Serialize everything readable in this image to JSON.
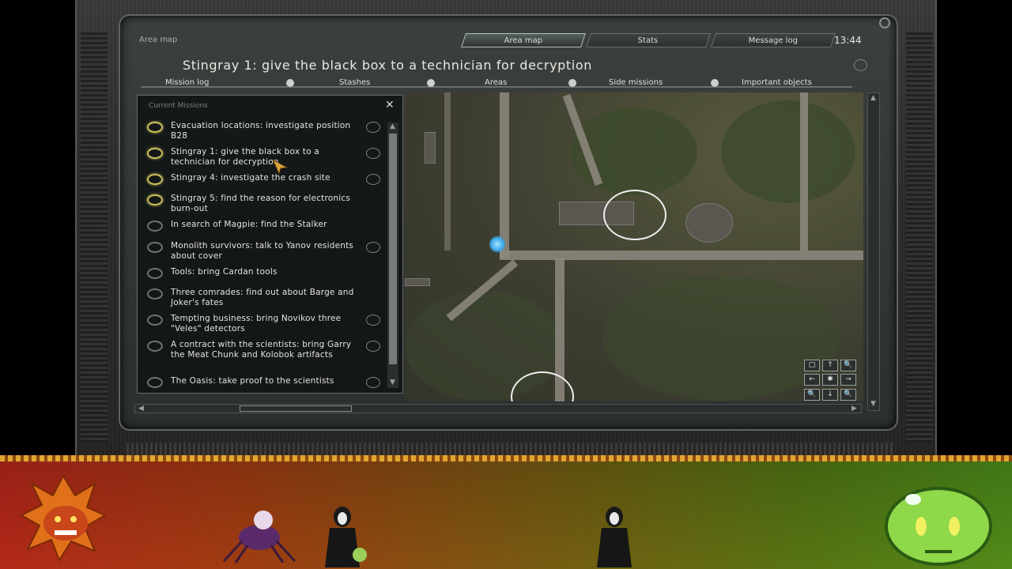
{
  "header": {
    "area_label": "Area map",
    "tabs": [
      {
        "label": "Area map",
        "active": true
      },
      {
        "label": "Stats",
        "active": false
      },
      {
        "label": "Message log",
        "active": false
      }
    ],
    "time": "13:44"
  },
  "title": "Stingray 1: give the black box to a technician for decryption",
  "subtabs": [
    "Mission log",
    "Stashes",
    "Areas",
    "Side missions",
    "Important objects"
  ],
  "missions_panel": {
    "title": "Current Missions",
    "items": [
      {
        "text": "Evacuation locations: investigate position B28",
        "active": true
      },
      {
        "text": "Stingray 1: give the black box to a technician for decryption",
        "active": true
      },
      {
        "text": "Stingray 4: investigate the crash site",
        "active": true
      },
      {
        "text": "Stingray 5: find the reason for electronics burn-out",
        "active": true
      },
      {
        "text": "In search of Magpie: find the Stalker",
        "active": false
      },
      {
        "text": "Monolith survivors: talk to Yanov residents about cover",
        "active": false
      },
      {
        "text": "Tools: bring Cardan tools",
        "active": false
      },
      {
        "text": "Three comrades: find out about Barge and Joker's fates",
        "active": false
      },
      {
        "text": "Tempting business: bring Novikov three \"Veles\" detectors",
        "active": false
      },
      {
        "text": "A contract with the scientists: bring Garry the Meat Chunk and Kolobok artifacts",
        "active": false
      },
      {
        "text": "The Oasis: take proof to the scientists",
        "active": false
      }
    ]
  },
  "map_controls": [
    "□",
    "↑",
    "🔍",
    "←",
    "✱",
    "→",
    "🔍",
    "↓",
    "🔍"
  ],
  "colors": {
    "active_mission": "#c8c05a",
    "overlay_left": "#b0241a",
    "overlay_right": "#4a8a1a"
  }
}
